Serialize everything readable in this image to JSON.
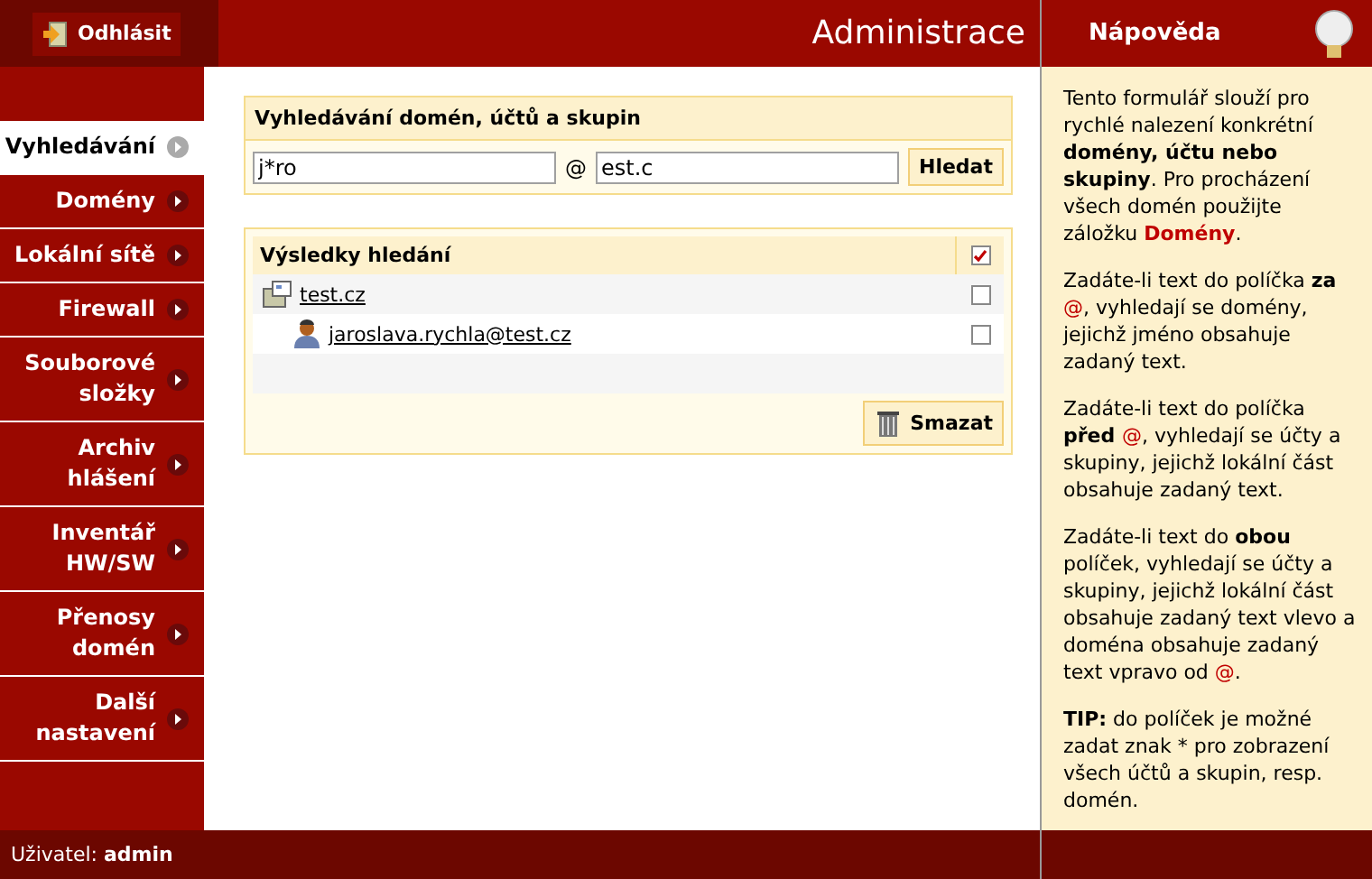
{
  "header": {
    "logout": "Odhlásit",
    "title": "Administrace"
  },
  "sidebar": {
    "items": [
      {
        "label": "Vyhledávání",
        "selected": true
      },
      {
        "label": "Domény",
        "selected": false
      },
      {
        "label": "Lokální sítě",
        "selected": false
      },
      {
        "label": "Firewall",
        "selected": false
      },
      {
        "label": "Souborové složky",
        "selected": false
      },
      {
        "label": "Archiv hlášení",
        "selected": false
      },
      {
        "label": "Inventář HW/SW",
        "selected": false
      },
      {
        "label": "Přenosy domén",
        "selected": false
      },
      {
        "label": "Další nastavení",
        "selected": false
      }
    ]
  },
  "search": {
    "title": "Vyhledávání domén, účtů a skupin",
    "local_value": "j*ro",
    "at": "@",
    "domain_value": "est.c",
    "button": "Hledat"
  },
  "results": {
    "title": "Výsledky hledání",
    "all_checked": true,
    "rows": [
      {
        "kind": "domain",
        "label": "test.cz",
        "checked": false
      },
      {
        "kind": "account",
        "label": "jaroslava.rychla@test.cz",
        "checked": false
      }
    ],
    "delete_button": "Smazat"
  },
  "help": {
    "title": "Nápověda",
    "paragraphs": [
      [
        {
          "kind": "plain",
          "text": "Tento formulář slouží pro rychlé nalezení konkrétní "
        },
        {
          "kind": "bold",
          "text": "domény, účtu nebo skupiny"
        },
        {
          "kind": "plain",
          "text": ". Pro procházení všech domén použijte záložku "
        },
        {
          "kind": "red-bold",
          "text": "Domény"
        },
        {
          "kind": "plain",
          "text": "."
        }
      ],
      [
        {
          "kind": "plain",
          "text": "Zadáte-li text do políčka "
        },
        {
          "kind": "bold",
          "text": "za "
        },
        {
          "kind": "red",
          "text": "@"
        },
        {
          "kind": "plain",
          "text": ", vyhledají se domény, jejichž jméno obsahuje zadaný text."
        }
      ],
      [
        {
          "kind": "plain",
          "text": "Zadáte-li text do políčka "
        },
        {
          "kind": "bold",
          "text": "před "
        },
        {
          "kind": "red",
          "text": "@"
        },
        {
          "kind": "plain",
          "text": ", vyhledají se účty a skupiny, jejichž lokální část obsahuje zadaný text."
        }
      ],
      [
        {
          "kind": "plain",
          "text": "Zadáte-li text do "
        },
        {
          "kind": "bold",
          "text": "obou"
        },
        {
          "kind": "plain",
          "text": " políček, vyhledají se účty a skupiny, jejichž lokální část obsahuje zadaný text vlevo a doména obsahuje zadaný text vpravo od "
        },
        {
          "kind": "red",
          "text": "@"
        },
        {
          "kind": "plain",
          "text": "."
        }
      ],
      [
        {
          "kind": "bold",
          "text": "TIP:"
        },
        {
          "kind": "plain",
          "text": " do políček je možné zadat znak * pro zobrazení všech účtů a skupin, resp. domén."
        }
      ]
    ]
  },
  "status_bar": {
    "user_label": "Uživatel:",
    "user": "admin"
  }
}
